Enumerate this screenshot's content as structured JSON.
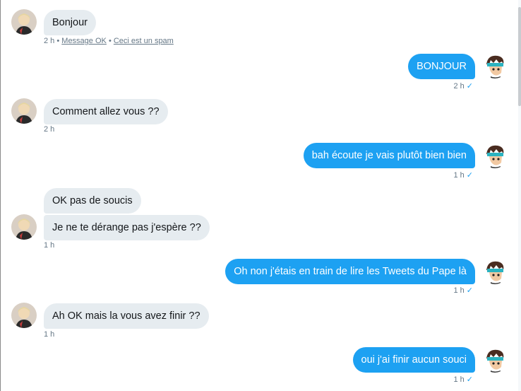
{
  "messages": [
    {
      "side": "in",
      "text": "Bonjour",
      "time": "2 h",
      "links": [
        "Message OK",
        "Ceci est un spam"
      ]
    },
    {
      "side": "out",
      "text": "BONJOUR",
      "time": "2 h"
    },
    {
      "side": "in",
      "text": "Comment allez vous ??",
      "time": "2 h"
    },
    {
      "side": "out",
      "text": "bah écoute je vais plutôt bien bien",
      "time": "1 h"
    },
    {
      "side": "in",
      "text": "OK pas de soucis"
    },
    {
      "side": "in",
      "text": "Je ne te dérange pas j'espère ??",
      "time": "1 h"
    },
    {
      "side": "out",
      "text": "Oh non j'étais en train de lire les Tweets du Pape là",
      "time": "1 h"
    },
    {
      "side": "in",
      "text": "Ah OK mais la vous avez finir ??",
      "time": "1 h"
    },
    {
      "side": "out",
      "text": "oui j'ai finir aucun souci",
      "time": "1 h"
    }
  ],
  "meta": {
    "separator": "•",
    "read_icon": "check-icon"
  },
  "colors": {
    "incoming_bubble": "#e6ecf0",
    "outgoing_bubble": "#1da1f2",
    "meta_text": "#657786"
  }
}
